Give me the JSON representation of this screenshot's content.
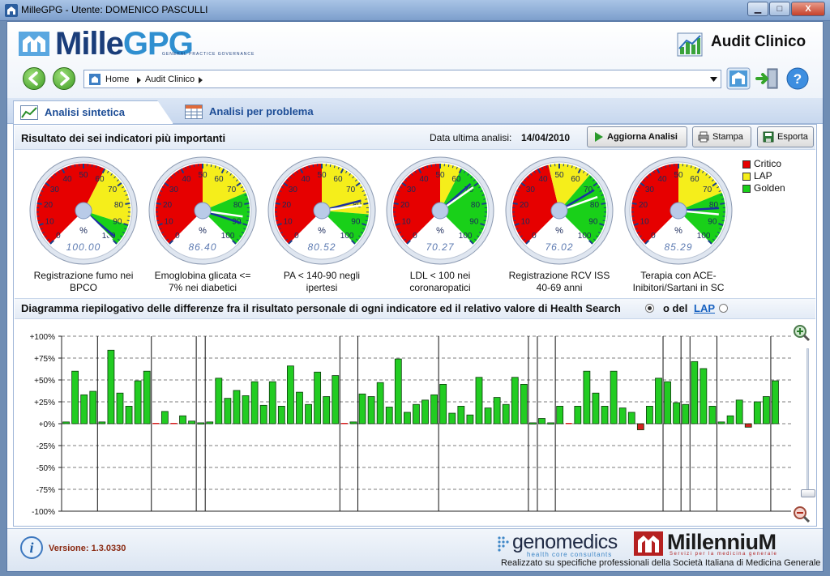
{
  "window": {
    "title": "MilleGPG - Utente: DOMENICO PASCULLI",
    "minimize": "▁",
    "maximize": "□",
    "close": "X"
  },
  "logo": {
    "mille": "Mille",
    "gpg": "GPG",
    "sub": "GENERAL PRACTICE GOVERNANCE"
  },
  "module": {
    "title": "Audit Clinico"
  },
  "breadcrumb": {
    "home": "Home",
    "current": "Audit Clinico"
  },
  "tabs": [
    {
      "label": "Analisi sintetica",
      "active": true
    },
    {
      "label": "Analisi per problema",
      "active": false
    }
  ],
  "section1": {
    "title": "Risultato dei sei indicatori più importanti",
    "date_label": "Data ultima analisi:",
    "date_value": "14/04/2010",
    "buttons": {
      "update": "Aggiorna Analisi",
      "print": "Stampa",
      "export": "Esporta"
    }
  },
  "legend": [
    {
      "label": "Critico",
      "color": "#e60000"
    },
    {
      "label": "LAP",
      "color": "#f5ee1b"
    },
    {
      "label": "Golden",
      "color": "#19d019"
    }
  ],
  "gauges": [
    {
      "label_line1": "Registrazione fumo nei",
      "label_line2": "BPCO",
      "display": "100.00",
      "value": 100,
      "zones": [
        60,
        90
      ],
      "needle2": 98
    },
    {
      "label_line1": "Emoglobina glicata <=",
      "label_line2": "7% nei diabetici",
      "display": "86.40",
      "value": 86.4,
      "zones": [
        50,
        75
      ],
      "needle2": 90
    },
    {
      "label_line1": "PA < 140-90 negli",
      "label_line2": "ipertesi",
      "display": "80.52",
      "value": 80.52,
      "zones": [
        50,
        85
      ],
      "needle2": 78
    },
    {
      "label_line1": "LDL < 100 nei",
      "label_line2": "coronaropatici",
      "display": "70.27",
      "value": 70.27,
      "zones": [
        50,
        60
      ],
      "needle2": 68
    },
    {
      "label_line1": "Registrazione RCV ISS",
      "label_line2": "40-69 anni",
      "display": "76.02",
      "value": 76.02,
      "zones": [
        45,
        65
      ],
      "needle2": 72
    },
    {
      "label_line1": "Terapia con ACE-",
      "label_line2": "Inibitori/Sartani in SC",
      "display": "85.29",
      "value": 85.29,
      "zones": [
        50,
        75
      ],
      "needle2": 82
    }
  ],
  "gauge_common": {
    "unit": "%",
    "ticks": [
      "0",
      "10",
      "20",
      "30",
      "40",
      "50",
      "60",
      "70",
      "80",
      "90",
      "100"
    ]
  },
  "section2": {
    "title": "Diagramma riepilogativo delle differenze fra il risultato personale di ogni indicatore ed il relativo valore di Health Search",
    "or_label": "o del",
    "lap_link": "LAP",
    "radio_hs_selected": true
  },
  "chart_data": {
    "type": "bar",
    "ylim": [
      -100,
      100
    ],
    "yticks": [
      "+100%",
      "+75%",
      "+50%",
      "+25%",
      "+0%",
      "-25%",
      "-50%",
      "-75%",
      "-100%"
    ],
    "ytick_values": [
      100,
      75,
      50,
      25,
      0,
      -25,
      -50,
      -75,
      -100
    ],
    "grid": true,
    "values": [
      2,
      60,
      33,
      37,
      2,
      84,
      35,
      20,
      49,
      60,
      0,
      14,
      0,
      9,
      3,
      1,
      2,
      52,
      29,
      38,
      32,
      48,
      21,
      48,
      20,
      66,
      36,
      22,
      59,
      31,
      55,
      0,
      2,
      34,
      31,
      47,
      19,
      74,
      13,
      22,
      27,
      33,
      45,
      12,
      20,
      10,
      53,
      18,
      30,
      22,
      53,
      45,
      1,
      6,
      1,
      20,
      0,
      20,
      60,
      35,
      20,
      60,
      18,
      13,
      -7,
      20,
      52,
      48,
      24,
      22,
      71,
      63,
      20,
      2,
      9,
      27,
      -4,
      25,
      31,
      49
    ],
    "colors": {
      "positive": "#22cc22",
      "negative": "#d42020",
      "zero": "#d42020"
    },
    "group_separators": [
      4,
      10,
      15,
      16,
      31,
      33,
      42,
      52,
      53,
      55,
      67,
      69,
      70,
      73,
      79
    ]
  },
  "footer": {
    "version": "Versione: 1.3.0330",
    "genomedics": "genomedics",
    "genomedics_sub": "health core consultants",
    "millennium": "MillenniuM",
    "millennium_sub": "Servizi per la medicina generale",
    "note": "Realizzato su specifiche professionali della Società Italiana di Medicina Generale"
  }
}
